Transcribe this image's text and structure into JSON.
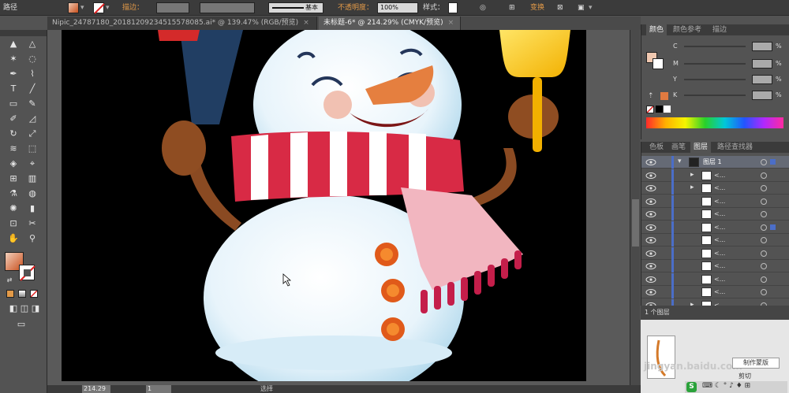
{
  "control_bar": {
    "label": "路径",
    "stroke_label": "描边：",
    "stroke_style": "基本",
    "opacity_label": "不透明度：",
    "opacity_value": "100%",
    "style_label": "样式：",
    "transform_label": "变换"
  },
  "tabs": [
    {
      "label": "Nipic_24787180_20181209234515578085.ai* @ 139.47% (RGB/预览)",
      "close": "×"
    },
    {
      "label": "未标题-6* @ 214.29% (CMYK/预览)",
      "close": "×"
    }
  ],
  "status": {
    "zoom": "214.29",
    "page": "1",
    "tool": "选择"
  },
  "color_panel": {
    "tabs": [
      "颜色",
      "颜色参考",
      "描边"
    ],
    "channels": [
      "C",
      "M",
      "Y",
      "K"
    ],
    "percent": "%"
  },
  "layers_panel": {
    "tabs": [
      "色板",
      "画笔",
      "图层",
      "路径查找器"
    ],
    "top_layer": "图层 1",
    "sublayer_label": "<...",
    "footer": "1 个图层"
  },
  "watermark": {
    "text": "jingyan.baidu.com",
    "button": "制作蒙版",
    "clip": "剪切"
  },
  "colors": {
    "accent": "#e39a48",
    "selection": "#4b6ec8",
    "fill_from": "#f0c8b0",
    "fill_to": "#c8501e"
  },
  "icons": [
    "selection-tool-icon",
    "direct-selection-tool-icon",
    "magic-wand-icon",
    "lasso-icon",
    "pen-icon",
    "curvature-icon",
    "type-icon",
    "line-icon",
    "rectangle-icon",
    "paintbrush-icon",
    "pencil-icon",
    "eraser-icon",
    "rotate-icon",
    "scale-icon",
    "width-icon",
    "free-transform-icon",
    "shape-builder-icon",
    "perspective-icon",
    "mesh-icon",
    "gradient-icon",
    "eyedropper-icon",
    "blend-icon",
    "symbol-sprayer-icon",
    "column-graph-icon",
    "artboard-icon",
    "slice-icon",
    "hand-icon",
    "zoom-icon"
  ]
}
